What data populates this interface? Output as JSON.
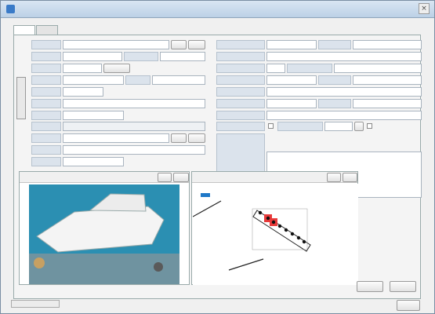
{
  "window": {
    "title": "",
    "close_glyph": "×"
  },
  "tabs": [
    "",
    ""
  ],
  "fields": {
    "ship_name": "",
    "ship_name_kana": "",
    "owner_code": "",
    "owner_name": "",
    "postal_code": "",
    "address": "",
    "phone": "",
    "registration": "",
    "inspection_name": "",
    "inspection_address": "",
    "insurance": "",
    "contract_no": "",
    "contract_value": "",
    "model": "",
    "length": "",
    "width": "",
    "tonnage": "",
    "weight": "",
    "other": "",
    "engine": "",
    "engine_value": "",
    "inspection_date": "",
    "storage_name": "",
    "extra_1": "",
    "extra_2": "",
    "memo": ""
  },
  "buttons": {
    "small_left": "",
    "small_right": "",
    "search": "",
    "save": "",
    "cancel": "",
    "close": ""
  },
  "status_text": ""
}
